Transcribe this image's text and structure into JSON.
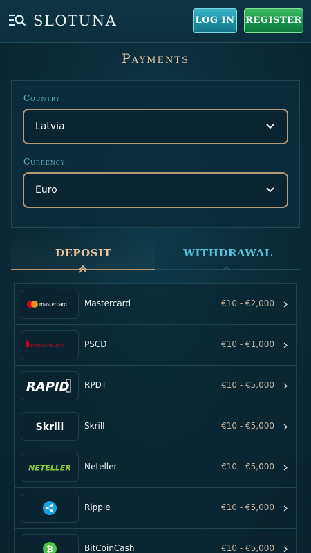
{
  "header": {
    "brand": "SLOTUNA",
    "login_label": "LOG IN",
    "register_label": "REGISTER"
  },
  "page": {
    "title": "Payments"
  },
  "filters": {
    "country_label": "Country",
    "country_value": "Latvia",
    "currency_label": "Currency",
    "currency_value": "Euro"
  },
  "tabs": {
    "deposit": "DEPOSIT",
    "withdrawal": "WITHDRAWAL",
    "active": "deposit"
  },
  "methods": [
    {
      "name": "Mastercard",
      "range": "€10 - €2,000",
      "logo_text": "mastercard",
      "icon": "mastercard-icon"
    },
    {
      "name": "PSCD",
      "range": "€10 - €1,000",
      "logo_text": "paysafecard",
      "icon": "paysafecard-icon"
    },
    {
      "name": "RPDT",
      "range": "€10 - €5,000",
      "logo_text": "RAPID",
      "icon": "rapid-transfer-icon"
    },
    {
      "name": "Skrill",
      "range": "€10 - €5,000",
      "logo_text": "Skrill",
      "icon": "skrill-icon"
    },
    {
      "name": "Neteller",
      "range": "€10 - €5,000",
      "logo_text": "NETELLER",
      "icon": "neteller-icon"
    },
    {
      "name": "Ripple",
      "range": "€10 - €5,000",
      "logo_text": "",
      "icon": "ripple-icon"
    },
    {
      "name": "BitCoinCash",
      "range": "€10 - €5,000",
      "logo_text": "",
      "icon": "bitcoin-cash-icon"
    }
  ],
  "colors": {
    "background": "#0b2c3a",
    "gold_accent": "#e3c9a6",
    "cyan_accent": "#58c4dc",
    "login_button": "#1d8ea3",
    "register_button": "#16924a"
  }
}
